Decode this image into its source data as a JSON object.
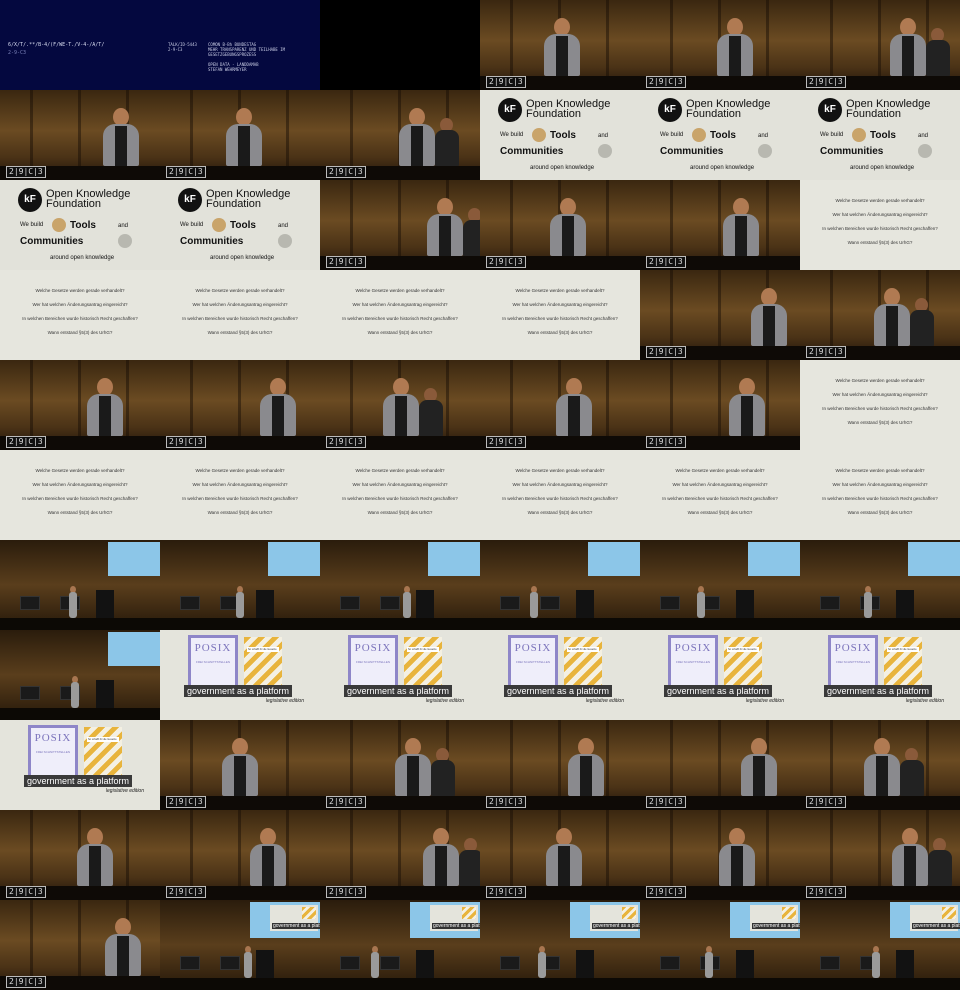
{
  "title_card": {
    "line1": "6/X/T/.**/B-4/(F/WE-T./V-4-/A/T/",
    "line2": "2-9-C3",
    "info1": "TALK/ID-5443\n2-9-C3",
    "info2": "COMON B-Bh BUNDESTAG\nMEHR TRANSPARENZ UND TEILHABE IM\nGESETZGEBUNGSPROZESS",
    "info3": "OPEN DATA - LANDDAMAB\nSTEFAN WEHRMEYER"
  },
  "okf_slide": {
    "badge": "kF",
    "name_line1": "Open Knowledge",
    "name_line2": "Foundation",
    "we_build": "We build",
    "tools": "Tools",
    "and": "and",
    "communities": "Communities",
    "around": "around open knowledge"
  },
  "question_slide": {
    "q1": "Welche Gesetze werden gerade verhandelt?",
    "q2": "Wer hat welchen Änderungsantrag eingereicht?",
    "q3": "In welchen Bereichen wurde historisch Recht geschaffen?",
    "q4": "Wann entstand §5(3) des UrhG?"
  },
  "posix_slide": {
    "book_title": "POSIX",
    "book_sub": "FREI SCHNITTSTELLEN",
    "stripe_label": "So schafft ihr die Gesetze",
    "gov": "government as a platform",
    "edition": "legislative edition"
  },
  "stage": {
    "logo": "2|9|C|3"
  }
}
